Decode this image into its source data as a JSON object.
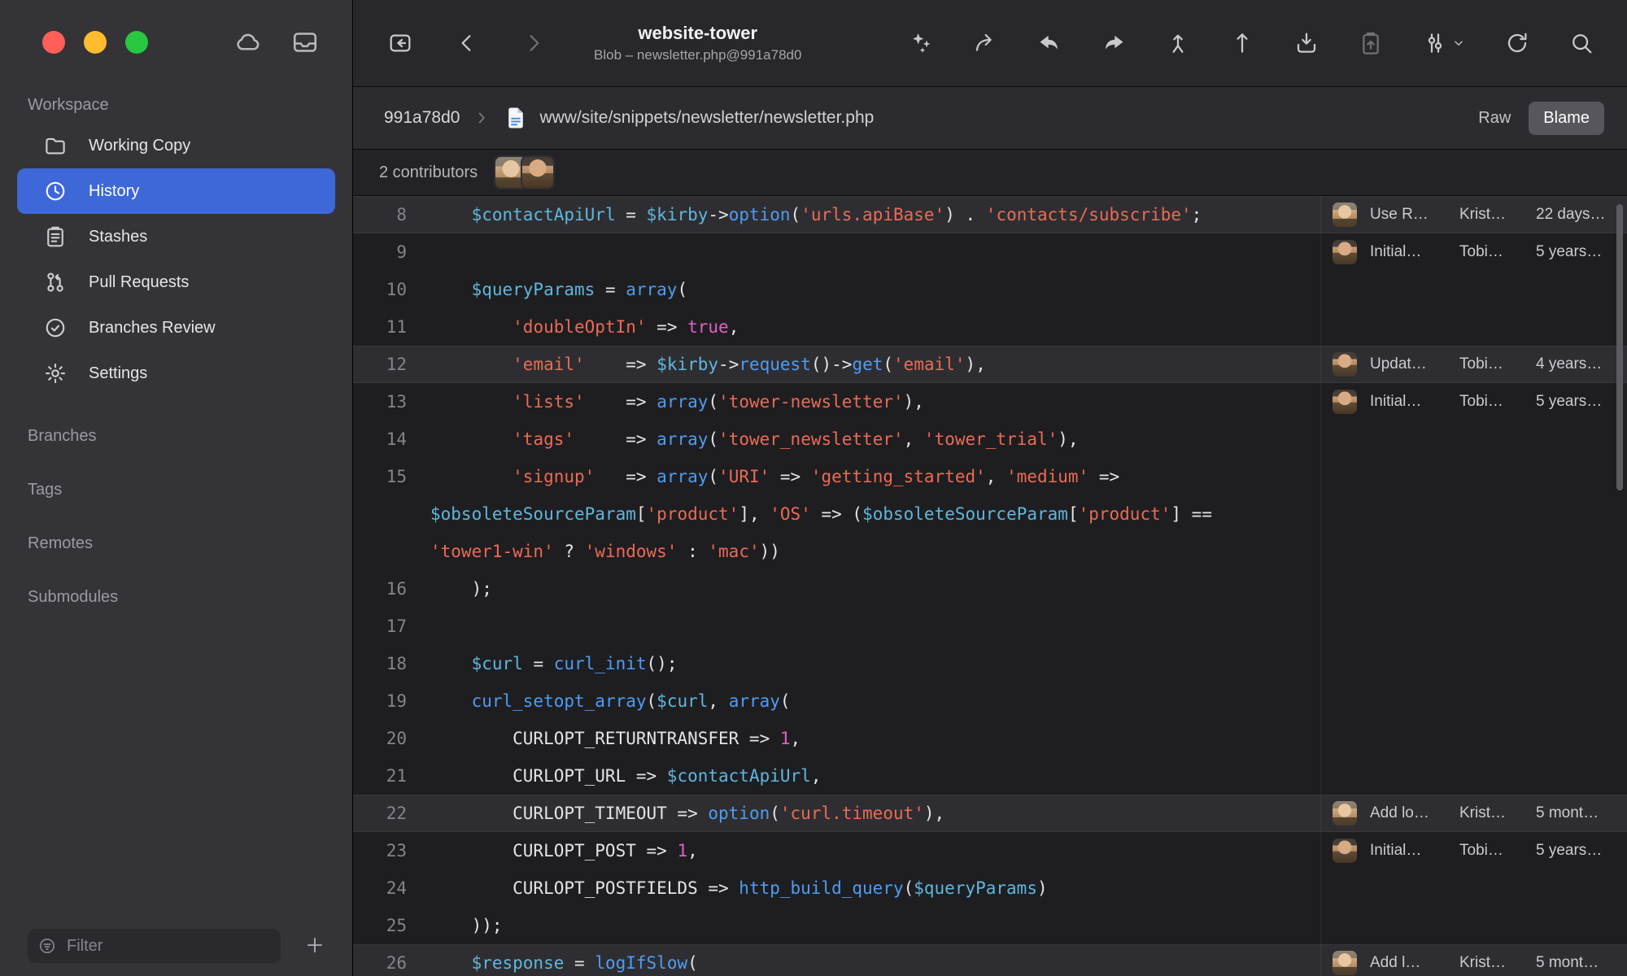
{
  "colors": {
    "accent": "#3e68d8",
    "sidebar_bg": "#343438",
    "code_bg": "#1e1e21",
    "highlight_row": "#2e2e32",
    "syntax": {
      "p": "#e4e4e6",
      "v": "#5fb7dd",
      "f": "#4f9cf0",
      "s": "#ec6a55",
      "k": "#e35fc5"
    }
  },
  "sidebar": {
    "workspace_label": "Workspace",
    "items": [
      {
        "label": "Working Copy",
        "icon": "folder-icon",
        "selected": false
      },
      {
        "label": "History",
        "icon": "clock-icon",
        "selected": true
      },
      {
        "label": "Stashes",
        "icon": "stash-icon",
        "selected": false
      },
      {
        "label": "Pull Requests",
        "icon": "pull-request-icon",
        "selected": false
      },
      {
        "label": "Branches Review",
        "icon": "review-icon",
        "selected": false
      },
      {
        "label": "Settings",
        "icon": "gear-icon",
        "selected": false
      }
    ],
    "groups": [
      "Branches",
      "Tags",
      "Remotes",
      "Submodules"
    ],
    "filter_placeholder": "Filter"
  },
  "toolbar": {
    "title": "website-tower",
    "subtitle": "Blob – newsletter.php@991a78d0",
    "left_buttons": [
      {
        "name": "view-box-button",
        "icon": "view-box-icon"
      },
      {
        "name": "back-button",
        "icon": "back-chevron-icon"
      },
      {
        "name": "forward-button",
        "icon": "forward-chevron-icon",
        "dim": true
      }
    ],
    "right_buttons": [
      {
        "name": "wand-button",
        "icon": "wand-icon"
      },
      {
        "name": "export-button",
        "icon": "export-icon"
      },
      {
        "name": "undo-button",
        "icon": "undo-icon"
      },
      {
        "name": "redo-button",
        "icon": "redo-icon"
      },
      {
        "name": "checkout-button",
        "icon": "checkout-icon"
      },
      {
        "name": "push-button",
        "icon": "arrow-up-icon"
      },
      {
        "name": "archive-button",
        "icon": "archive-down-icon"
      },
      {
        "name": "clipboard-button",
        "icon": "clipboard-up-icon",
        "disabled": true
      },
      {
        "name": "view-options-button",
        "icon": "adjust-icon",
        "dropdown": true
      },
      {
        "name": "refresh-button",
        "icon": "refresh-icon"
      },
      {
        "name": "search-button",
        "icon": "search-icon"
      }
    ]
  },
  "breadcrumb": {
    "commit": "991a78d0",
    "path": "www/site/snippets/newsletter/newsletter.php",
    "raw_label": "Raw",
    "blame_label": "Blame",
    "active_view": "Blame"
  },
  "contributors": {
    "label": "2 contributors",
    "avatars": [
      "kristian",
      "tobias"
    ]
  },
  "code": {
    "rows": [
      {
        "num": "8",
        "hl": true,
        "blame": {
          "avatar": "kristian",
          "msg": "Use R…",
          "author": "Krist…",
          "date": "22 days…"
        },
        "tokens": [
          [
            "p",
            "    "
          ],
          [
            "v",
            "$contactApiUrl"
          ],
          [
            "p",
            " = "
          ],
          [
            "v",
            "$kirby"
          ],
          [
            "p",
            "->"
          ],
          [
            "f",
            "option"
          ],
          [
            "p",
            "("
          ],
          [
            "s",
            "'urls.apiBase'"
          ],
          [
            "p",
            ") . "
          ],
          [
            "s",
            "'contacts/subscribe'"
          ],
          [
            "p",
            ";"
          ]
        ]
      },
      {
        "num": "9",
        "hl": false,
        "blame": {
          "avatar": "tobias",
          "msg": "Initial…",
          "author": "Tobi…",
          "date": "5 years…"
        },
        "tokens": []
      },
      {
        "num": "10",
        "hl": false,
        "tokens": [
          [
            "p",
            "    "
          ],
          [
            "v",
            "$queryParams"
          ],
          [
            "p",
            " = "
          ],
          [
            "f",
            "array"
          ],
          [
            "p",
            "("
          ]
        ]
      },
      {
        "num": "11",
        "hl": false,
        "tokens": [
          [
            "p",
            "        "
          ],
          [
            "s",
            "'doubleOptIn'"
          ],
          [
            "p",
            " => "
          ],
          [
            "k",
            "true"
          ],
          [
            "p",
            ","
          ]
        ]
      },
      {
        "num": "12",
        "hl": true,
        "blame": {
          "avatar": "tobias",
          "msg": "Updat…",
          "author": "Tobi…",
          "date": "4 years…"
        },
        "tokens": [
          [
            "p",
            "        "
          ],
          [
            "s",
            "'email'"
          ],
          [
            "p",
            "    => "
          ],
          [
            "v",
            "$kirby"
          ],
          [
            "p",
            "->"
          ],
          [
            "f",
            "request"
          ],
          [
            "p",
            "()->"
          ],
          [
            "f",
            "get"
          ],
          [
            "p",
            "("
          ],
          [
            "s",
            "'email'"
          ],
          [
            "p",
            "),"
          ]
        ]
      },
      {
        "num": "13",
        "hl": false,
        "blame": {
          "avatar": "tobias",
          "msg": "Initial…",
          "author": "Tobi…",
          "date": "5 years…"
        },
        "tokens": [
          [
            "p",
            "        "
          ],
          [
            "s",
            "'lists'"
          ],
          [
            "p",
            "    => "
          ],
          [
            "f",
            "array"
          ],
          [
            "p",
            "("
          ],
          [
            "s",
            "'tower-newsletter'"
          ],
          [
            "p",
            "),"
          ]
        ]
      },
      {
        "num": "14",
        "hl": false,
        "tokens": [
          [
            "p",
            "        "
          ],
          [
            "s",
            "'tags'"
          ],
          [
            "p",
            "     => "
          ],
          [
            "f",
            "array"
          ],
          [
            "p",
            "("
          ],
          [
            "s",
            "'tower_newsletter'"
          ],
          [
            "p",
            ", "
          ],
          [
            "s",
            "'tower_trial'"
          ],
          [
            "p",
            "),"
          ]
        ]
      },
      {
        "num": "15",
        "hl": false,
        "tokens": [
          [
            "p",
            "        "
          ],
          [
            "s",
            "'signup'"
          ],
          [
            "p",
            "   => "
          ],
          [
            "f",
            "array"
          ],
          [
            "p",
            "("
          ],
          [
            "s",
            "'URI'"
          ],
          [
            "p",
            " => "
          ],
          [
            "s",
            "'getting_started'"
          ],
          [
            "p",
            ", "
          ],
          [
            "s",
            "'medium'"
          ],
          [
            "p",
            " =>"
          ]
        ]
      },
      {
        "num": "",
        "hl": false,
        "tokens": [
          [
            "v",
            "$obsoleteSourceParam"
          ],
          [
            "p",
            "["
          ],
          [
            "s",
            "'product'"
          ],
          [
            "p",
            "], "
          ],
          [
            "s",
            "'OS'"
          ],
          [
            "p",
            " => ("
          ],
          [
            "v",
            "$obsoleteSourceParam"
          ],
          [
            "p",
            "["
          ],
          [
            "s",
            "'product'"
          ],
          [
            "p",
            "] =="
          ]
        ]
      },
      {
        "num": "",
        "hl": false,
        "tokens": [
          [
            "s",
            "'tower1-win'"
          ],
          [
            "p",
            " ? "
          ],
          [
            "s",
            "'windows'"
          ],
          [
            "p",
            " : "
          ],
          [
            "s",
            "'mac'"
          ],
          [
            "p",
            "))"
          ]
        ]
      },
      {
        "num": "16",
        "hl": false,
        "tokens": [
          [
            "p",
            "    );"
          ]
        ]
      },
      {
        "num": "17",
        "hl": false,
        "tokens": []
      },
      {
        "num": "18",
        "hl": false,
        "tokens": [
          [
            "p",
            "    "
          ],
          [
            "v",
            "$curl"
          ],
          [
            "p",
            " = "
          ],
          [
            "f",
            "curl_init"
          ],
          [
            "p",
            "();"
          ]
        ]
      },
      {
        "num": "19",
        "hl": false,
        "tokens": [
          [
            "p",
            "    "
          ],
          [
            "f",
            "curl_setopt_array"
          ],
          [
            "p",
            "("
          ],
          [
            "v",
            "$curl"
          ],
          [
            "p",
            ", "
          ],
          [
            "f",
            "array"
          ],
          [
            "p",
            "("
          ]
        ]
      },
      {
        "num": "20",
        "hl": false,
        "tokens": [
          [
            "p",
            "        CURLOPT_RETURNTRANSFER => "
          ],
          [
            "k",
            "1"
          ],
          [
            "p",
            ","
          ]
        ]
      },
      {
        "num": "21",
        "hl": false,
        "tokens": [
          [
            "p",
            "        CURLOPT_URL => "
          ],
          [
            "v",
            "$contactApiUrl"
          ],
          [
            "p",
            ","
          ]
        ]
      },
      {
        "num": "22",
        "hl": true,
        "blame": {
          "avatar": "kristian",
          "msg": "Add lo…",
          "author": "Krist…",
          "date": "5 mont…"
        },
        "tokens": [
          [
            "p",
            "        CURLOPT_TIMEOUT => "
          ],
          [
            "f",
            "option"
          ],
          [
            "p",
            "("
          ],
          [
            "s",
            "'curl.timeout'"
          ],
          [
            "p",
            "),"
          ]
        ]
      },
      {
        "num": "23",
        "hl": false,
        "blame": {
          "avatar": "tobias",
          "msg": "Initial…",
          "author": "Tobi…",
          "date": "5 years…"
        },
        "tokens": [
          [
            "p",
            "        CURLOPT_POST => "
          ],
          [
            "k",
            "1"
          ],
          [
            "p",
            ","
          ]
        ]
      },
      {
        "num": "24",
        "hl": false,
        "tokens": [
          [
            "p",
            "        CURLOPT_POSTFIELDS => "
          ],
          [
            "f",
            "http_build_query"
          ],
          [
            "p",
            "("
          ],
          [
            "v",
            "$queryParams"
          ],
          [
            "p",
            ")"
          ]
        ]
      },
      {
        "num": "25",
        "hl": false,
        "tokens": [
          [
            "p",
            "    ));"
          ]
        ]
      },
      {
        "num": "26",
        "hl": true,
        "blame": {
          "avatar": "kristian",
          "msg": "Add l…",
          "author": "Krist…",
          "date": "5 mont…"
        },
        "tokens": [
          [
            "p",
            "    "
          ],
          [
            "v",
            "$response"
          ],
          [
            "p",
            " = "
          ],
          [
            "f",
            "logIfSlow"
          ],
          [
            "p",
            "("
          ]
        ]
      }
    ]
  }
}
